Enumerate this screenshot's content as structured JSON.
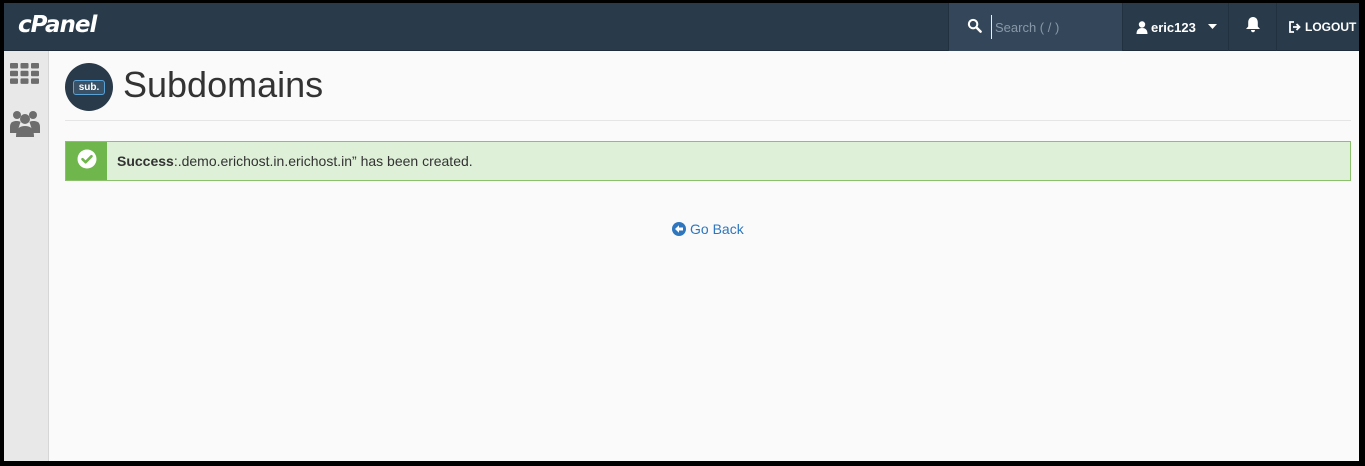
{
  "topbar": {
    "brand": "cPanel",
    "search_placeholder": "Search ( / )",
    "username": "eric123",
    "logout_label": "LOGOUT"
  },
  "sidebar": {
    "items": [
      {
        "icon": "grid-icon"
      },
      {
        "icon": "users-icon"
      }
    ]
  },
  "page": {
    "app_icon_text": "sub.",
    "title": "Subdomains"
  },
  "alert": {
    "label": "Success",
    "message": ":.demo.erichost.in.erichost.in” has been created."
  },
  "actions": {
    "go_back": "Go Back"
  },
  "colors": {
    "topbar": "#293a4a",
    "alert_bg": "#dff0d8",
    "alert_accent": "#6fb64c",
    "link": "#2e76bd"
  }
}
